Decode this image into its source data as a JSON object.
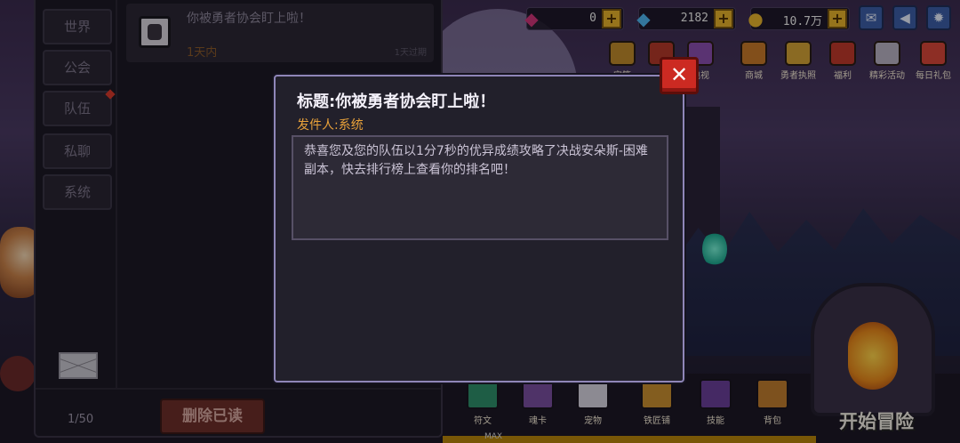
{
  "resources": {
    "red_gem": "0",
    "blue_gem": "2182",
    "gold": "10.7万"
  },
  "nav_icons": [
    {
      "label": "宝箱",
      "icon": "chest-icon",
      "color": "#c08a2c"
    },
    {
      "label": "",
      "icon": "character-icon",
      "color": "#b43a2a"
    },
    {
      "label": "电视",
      "icon": "tv-icon",
      "color": "#8a4fb0"
    },
    {
      "label": "商城",
      "icon": "shop-icon",
      "color": "#c87a2a"
    },
    {
      "label": "勇者执照",
      "icon": "license-icon",
      "color": "#d4a436"
    },
    {
      "label": "福利",
      "icon": "gift-icon",
      "color": "#c0392b"
    },
    {
      "label": "精彩活动",
      "icon": "event-icon",
      "color": "#b8b2c4"
    },
    {
      "label": "每日礼包",
      "icon": "daily-gift-icon",
      "color": "#d9473a"
    }
  ],
  "bottom_menu": [
    {
      "label": "符文",
      "icon": "rune-icon",
      "color": "#2f8f6a"
    },
    {
      "label": "魂卡",
      "icon": "soul-card-icon",
      "color": "#7a4fa0"
    },
    {
      "label": "宠物",
      "icon": "pet-icon",
      "color": "#d8d4e0"
    },
    {
      "label": "铁匠铺",
      "icon": "anvil-icon",
      "color": "#c98f30"
    },
    {
      "label": "技能",
      "icon": "skill-book-icon",
      "color": "#6a3f9a"
    },
    {
      "label": "背包",
      "icon": "backpack-icon",
      "color": "#c07d2e"
    }
  ],
  "start_adventure": "开始冒险",
  "xp_max": "MAX",
  "mail": {
    "categories": [
      "世界",
      "公会",
      "队伍",
      "私聊",
      "系统"
    ],
    "item": {
      "title": "你被勇者协会盯上啦！",
      "time": "1天内",
      "expire": "1天过期"
    },
    "page_count": "1/50",
    "delete_read": "删除已读"
  },
  "dialog": {
    "title": "标题:你被勇者协会盯上啦！",
    "sender": "发件人:系统",
    "body": "恭喜您及您的队伍以1分7秒的优异成绩攻略了决战安朵斯-困难副本，快去排行榜上查看你的排名吧！",
    "close": "✕"
  }
}
